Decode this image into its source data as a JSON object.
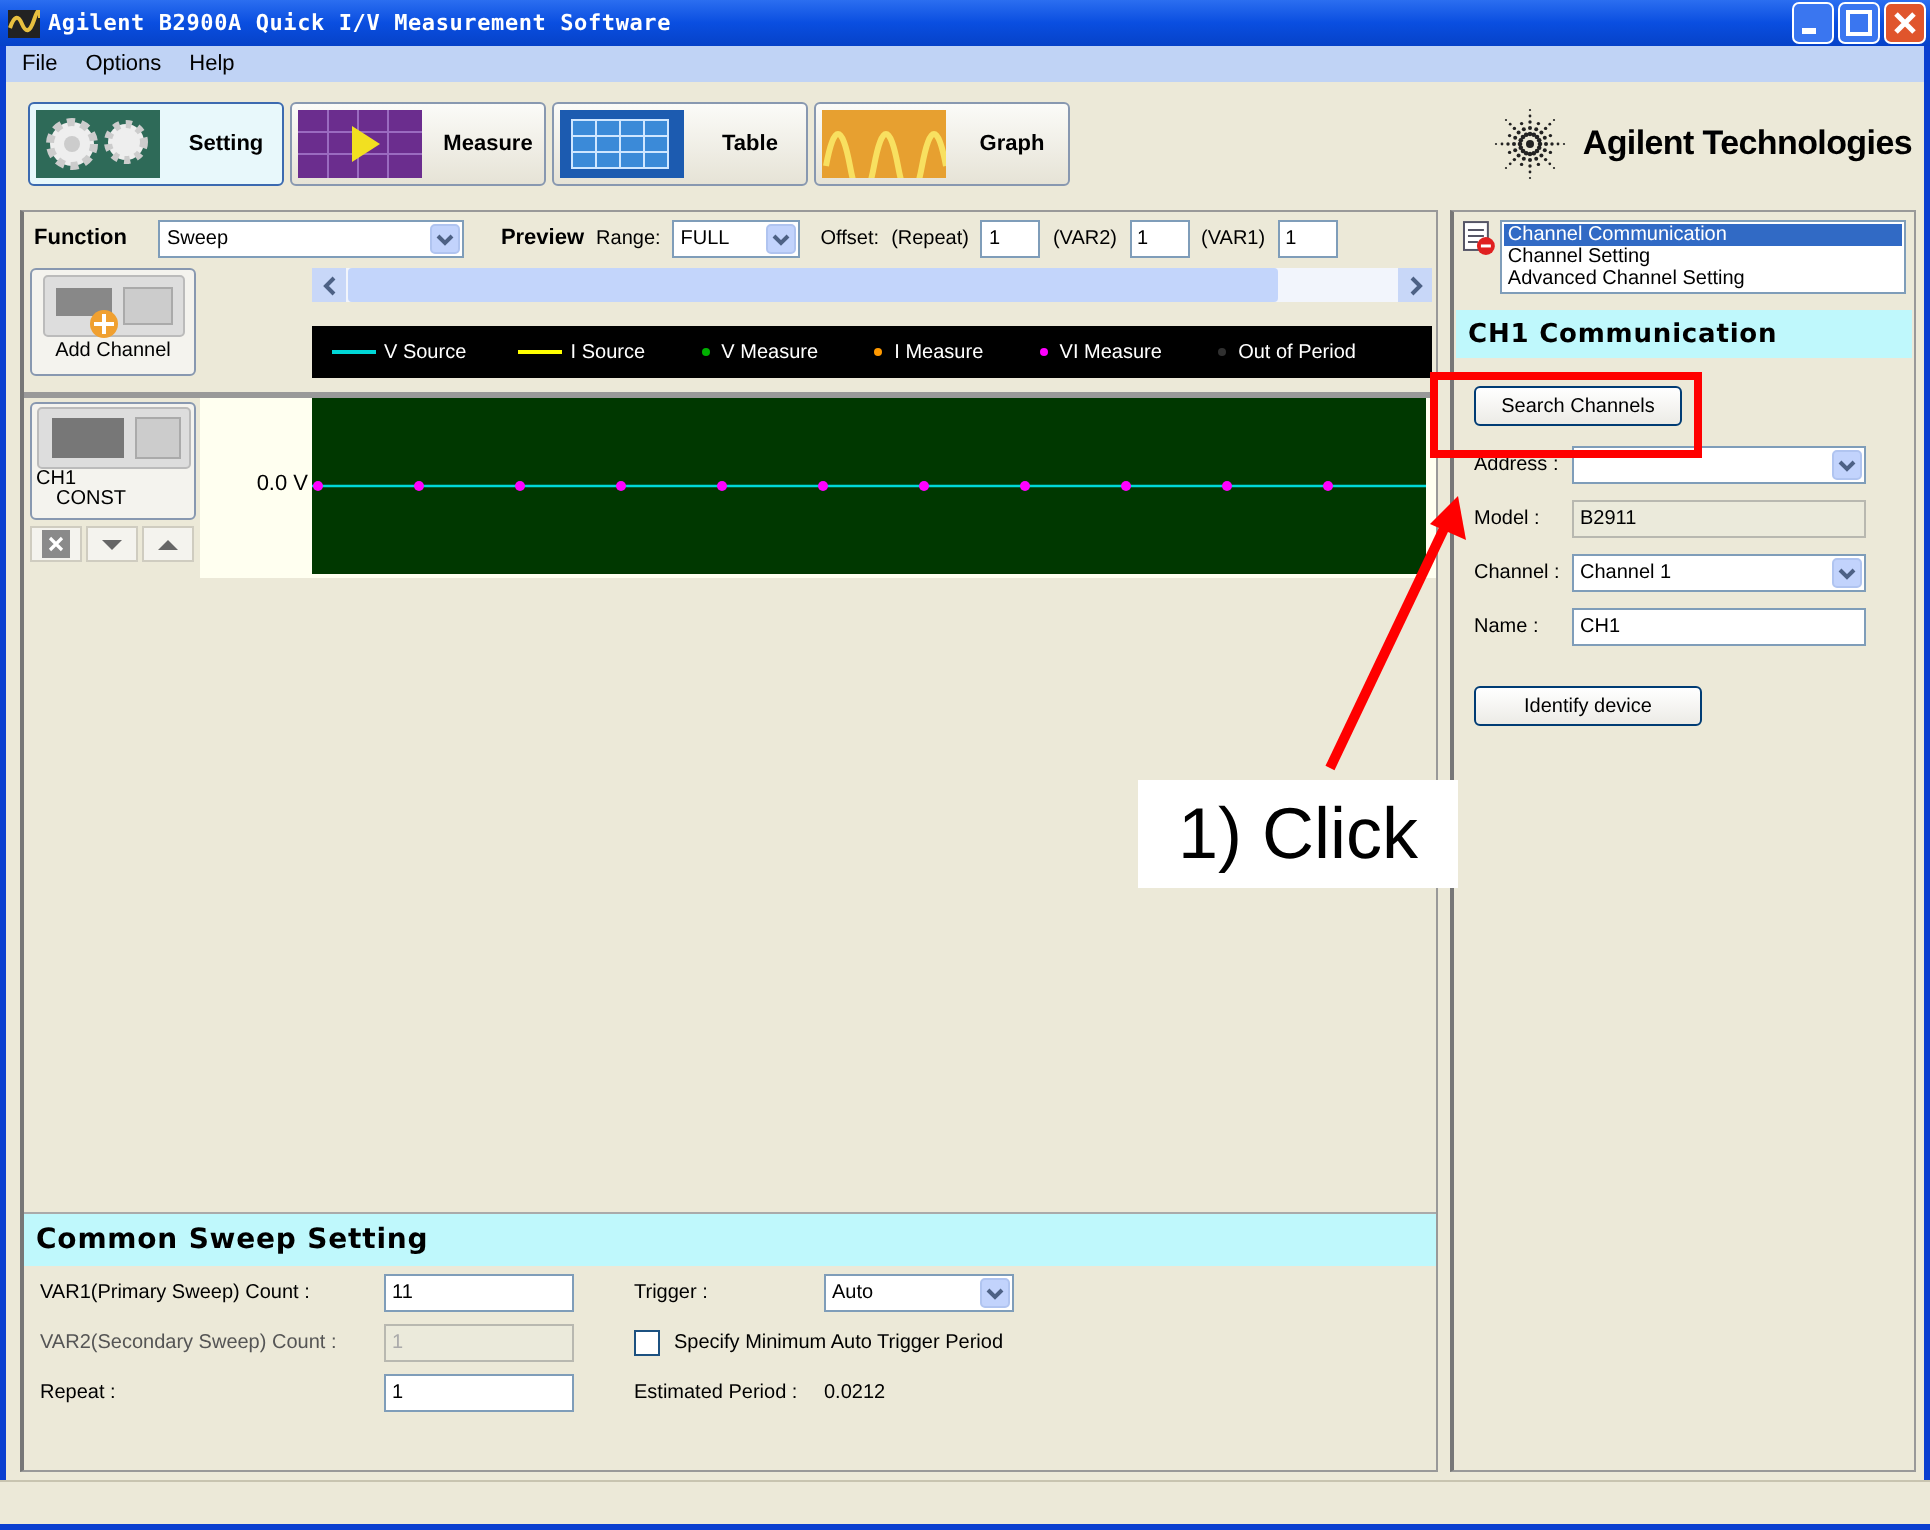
{
  "window": {
    "title": "Agilent B2900A Quick I/V Measurement Software"
  },
  "menu": [
    {
      "label": "File"
    },
    {
      "label": "Options"
    },
    {
      "label": "Help"
    }
  ],
  "mode_buttons": [
    {
      "label": "Setting",
      "selected": true,
      "kind": "gears"
    },
    {
      "label": "Measure",
      "selected": false,
      "kind": "play"
    },
    {
      "label": "Table",
      "selected": false,
      "kind": "grid"
    },
    {
      "label": "Graph",
      "selected": false,
      "kind": "wave"
    }
  ],
  "logo": {
    "text": "Agilent Technologies"
  },
  "function_bar": {
    "label": "Function",
    "value": "Sweep",
    "preview_label": "Preview",
    "range_label": "Range:",
    "range": "FULL",
    "offset_label": "Offset:",
    "offsets": [
      {
        "label": "(Repeat)",
        "value": "1"
      },
      {
        "label": "(VAR2)",
        "value": "1"
      },
      {
        "label": "(VAR1)",
        "value": "1"
      }
    ]
  },
  "add_channel": {
    "label": "Add Channel"
  },
  "legend": [
    {
      "label": "V Source",
      "kind": "line",
      "color": "#00d8d8"
    },
    {
      "label": "I Source",
      "kind": "line",
      "color": "#ffff00"
    },
    {
      "label": "V Measure",
      "kind": "dot",
      "color": "#00b000"
    },
    {
      "label": "I Measure",
      "kind": "dot",
      "color": "#ff9900"
    },
    {
      "label": "VI Measure",
      "kind": "dot",
      "color": "#ff00ff"
    },
    {
      "label": "Out of Period",
      "kind": "dot",
      "color": "#303030"
    }
  ],
  "channels": [
    {
      "name": "CH1",
      "mode": "CONST",
      "axis_label": "0.0 V"
    }
  ],
  "common_sweep": {
    "title": "Common Sweep Setting",
    "left_fields": [
      {
        "label": "VAR1(Primary Sweep) Count :",
        "value": "11",
        "disabled": false
      },
      {
        "label": "VAR2(Secondary Sweep) Count :",
        "value": "1",
        "disabled": true
      },
      {
        "label": "Repeat :",
        "value": "1",
        "disabled": false
      }
    ],
    "trigger": {
      "label": "Trigger :",
      "value": "Auto"
    },
    "min_period": {
      "label": "Specify Minimum Auto Trigger Period",
      "checked": false
    },
    "estimated": {
      "label": "Estimated Period :",
      "value": "0.0212"
    }
  },
  "side_panel": {
    "nav": [
      {
        "label": "Channel Communication",
        "selected": true
      },
      {
        "label": "Channel Setting",
        "selected": false
      },
      {
        "label": "Advanced Channel Setting",
        "selected": false
      }
    ],
    "title": "CH1 Communication",
    "search_button": "Search Channels",
    "fields": [
      {
        "label": "Address :",
        "kind": "select"
      },
      {
        "label": "Model :",
        "kind": "readonly",
        "value": "B2911"
      },
      {
        "label": "Channel :",
        "kind": "select",
        "value": "Channel 1"
      },
      {
        "label": "Name :",
        "kind": "text",
        "value": "CH1"
      }
    ],
    "identify_button": "Identify device"
  },
  "annotation": {
    "text": "1) Click"
  }
}
